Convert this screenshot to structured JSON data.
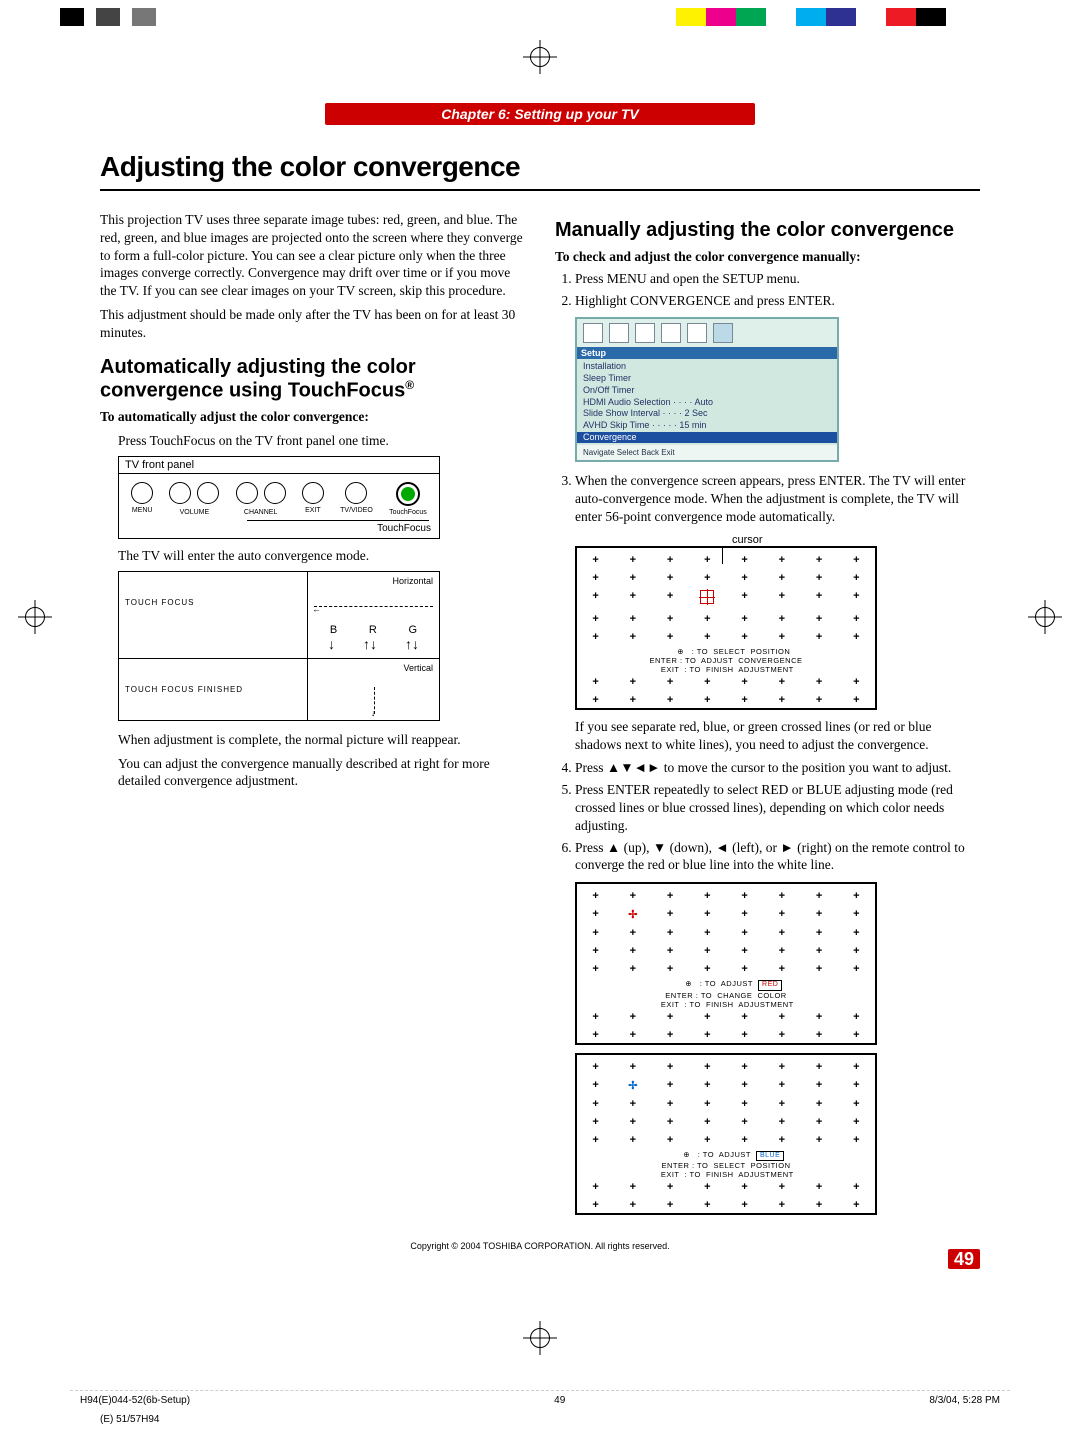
{
  "chapter": "Chapter 6: Setting up your TV",
  "title": "Adjusting the color convergence",
  "intro1": "This projection TV uses three separate image tubes: red, green, and blue. The red, green, and blue images are projected onto the screen where they converge to form a full-color picture. You can see a clear picture only when the three images converge correctly. Convergence may drift over time or if you move the TV. If you can see clear images on your TV screen, skip this procedure.",
  "intro2": "This adjustment should be made only after the TV has been on for at least 30 minutes.",
  "auto_heading": "Automatically adjusting the color convergence using TouchFocus",
  "auto_reg": "®",
  "auto_sub": "To automatically adjust the color convergence:",
  "auto_step": "Press TouchFocus on the TV front panel one time.",
  "tv_panel_label": "TV front panel",
  "tv_buttons": {
    "menu": "MENU",
    "volume": "VOLUME",
    "channel": "CHANNEL",
    "exit": "EXIT",
    "tvvideo": "TV/VIDEO",
    "touchfocus": "TouchFocus"
  },
  "touchfocus_caption": "TouchFocus",
  "auto_after1": "The TV will enter the auto convergence mode.",
  "tf_touch": "TOUCH  FOCUS",
  "tf_finished": "TOUCH  FOCUS  FINISHED",
  "tf_horizontal": "Horizontal",
  "tf_vertical": "Vertical",
  "tf_b": "B",
  "tf_r": "R",
  "tf_g": "G",
  "auto_after2": "When adjustment is complete, the normal picture will reappear.",
  "auto_after3": "You can adjust the convergence manually described at right for more detailed convergence adjustment.",
  "manual_heading": "Manually adjusting the color convergence",
  "manual_sub": "To check and adjust the color convergence manually:",
  "m_step1": "Press MENU and open the SETUP menu.",
  "m_step2": "Highlight CONVERGENCE and press ENTER.",
  "menu": {
    "setup": "Setup",
    "items": [
      "Installation",
      "Sleep Timer",
      "On/Off Timer",
      "HDMI Audio Selection · · · · Auto",
      "Slide Show Interval · · · · 2 Sec",
      "AVHD Skip Time · · · · · 15 min",
      "Convergence"
    ],
    "nav": "Navigate      Select      Back      Exit"
  },
  "m_step3": "When the convergence screen appears, press ENTER. The TV will enter auto-convergence mode. When the adjustment is complete, the TV will enter 56-point convergence mode automatically.",
  "cursor_label": "cursor",
  "grid1_legend": "      ⊕   : TO  SELECT  POSITION\nENTER : TO  ADJUST  CONVERGENCE\n EXIT  : TO  FINISH  ADJUSTMENT",
  "m_after3": "If you see separate red, blue, or green crossed lines (or red or blue shadows next to white lines), you need to adjust the convergence.",
  "m_step4_a": "Press ",
  "m_step4_sym": "▲▼◄►",
  "m_step4_b": " to move the cursor to the position you want to adjust.",
  "m_step5": "Press ENTER repeatedly to select RED or BLUE adjusting mode (red crossed lines or blue crossed lines), depending on which color needs adjusting.",
  "m_step6": "Press ▲ (up), ▼ (down), ◄ (left), or ► (right) on the remote control to converge the red or blue line into the white line.",
  "grid2_legend": "      ⊕   : TO  ADJUST  RED\nENTER : TO  CHANGE  COLOR\n EXIT  : TO  FINISH  ADJUSTMENT",
  "grid3_legend": "      ⊕   : TO  ADJUST  BLUE\nENTER : TO  SELECT  POSITION\n EXIT  : TO  FINISH  ADJUSTMENT",
  "red_label": "RED",
  "blue_label": "BLUE",
  "copyright": "Copyright © 2004 TOSHIBA CORPORATION. All rights reserved.",
  "page_num": "49",
  "foot_left": "H94(E)044-52(6b-Setup)",
  "foot_mid": "49",
  "foot_right": "8/3/04, 5:28 PM",
  "foot_code": "(E) 51/57H94"
}
